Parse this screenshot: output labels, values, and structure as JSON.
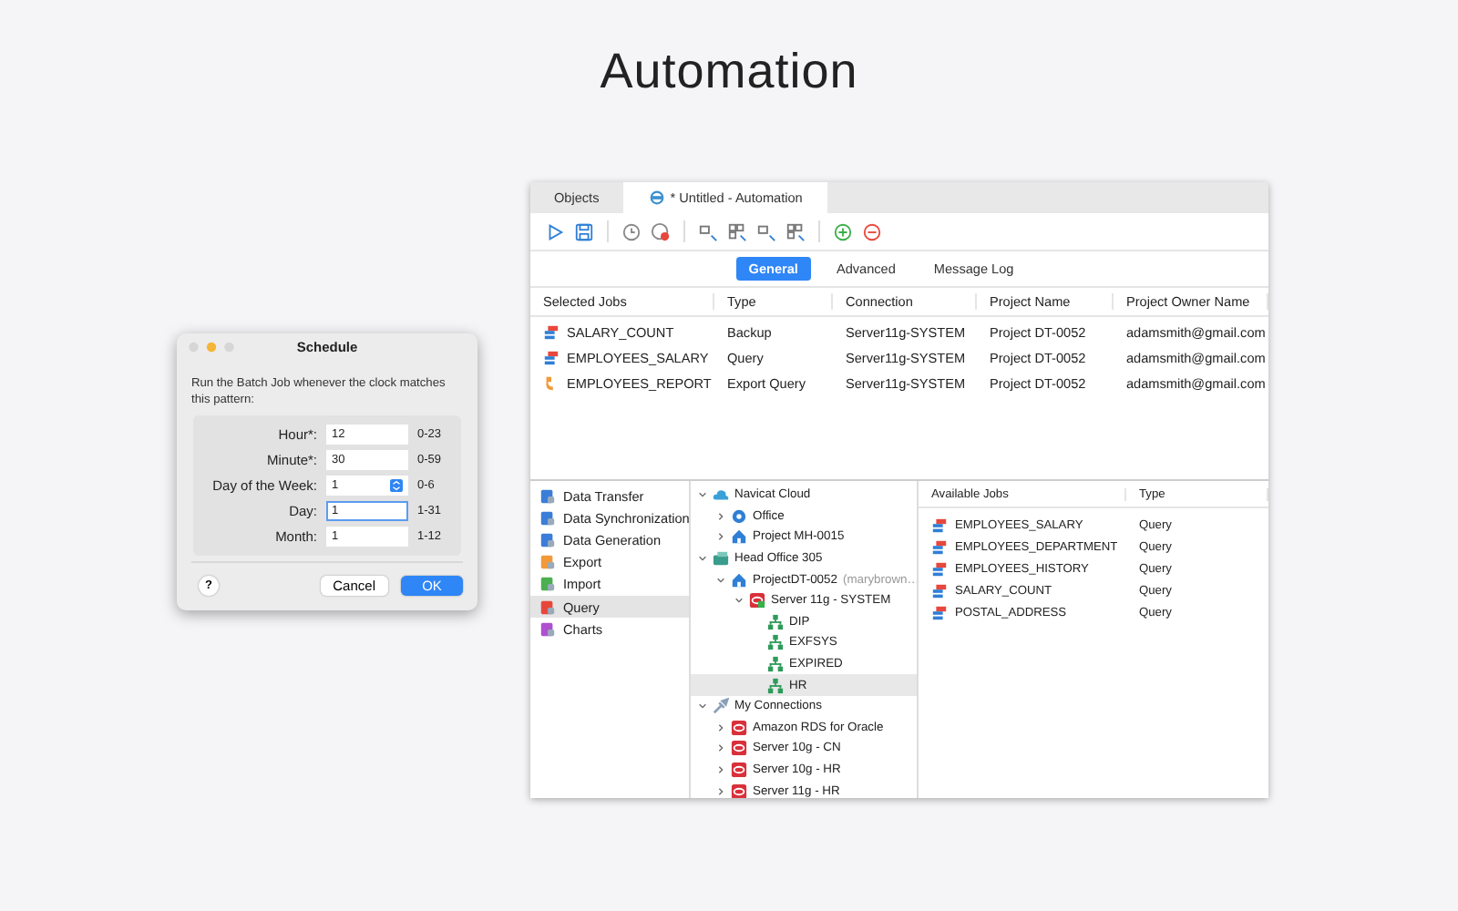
{
  "heading": "Automation",
  "main_window": {
    "tabs": [
      {
        "label": "Objects",
        "selected": false,
        "kind": "plain"
      },
      {
        "label": "* Untitled - Automation",
        "selected": true,
        "kind": "automation"
      }
    ],
    "view_tabs": [
      {
        "label": "General",
        "selected": true
      },
      {
        "label": "Advanced",
        "selected": false
      },
      {
        "label": "Message Log",
        "selected": false
      }
    ],
    "selected_jobs": {
      "columns": [
        "Selected Jobs",
        "Type",
        "Connection",
        "Project Name",
        "Project Owner Name"
      ],
      "rows": [
        {
          "kind": "backup",
          "cells": [
            "SALARY_COUNT",
            "Backup",
            "Server11g-SYSTEM",
            "Project DT-0052",
            "adamsmith@gmail.com"
          ]
        },
        {
          "kind": "query",
          "cells": [
            "EMPLOYEES_SALARY",
            "Query",
            "Server11g-SYSTEM",
            "Project DT-0052",
            "adamsmith@gmail.com"
          ]
        },
        {
          "kind": "export",
          "cells": [
            "EMPLOYEES_REPORT",
            "Export Query",
            "Server11g-SYSTEM",
            "Project DT-0052",
            "adamsmith@gmail.com"
          ]
        }
      ]
    },
    "job_types": [
      {
        "label": "Data Transfer",
        "kind": "transfer",
        "selected": false
      },
      {
        "label": "Data Synchronization",
        "kind": "sync",
        "selected": false
      },
      {
        "label": "Data Generation",
        "kind": "generation",
        "selected": false
      },
      {
        "label": "Export",
        "kind": "export",
        "selected": false
      },
      {
        "label": "Import",
        "kind": "import",
        "selected": false
      },
      {
        "label": "Query",
        "kind": "query",
        "selected": true
      },
      {
        "label": "Charts",
        "kind": "charts",
        "selected": false
      }
    ],
    "tree": [
      {
        "label": "Navicat Cloud",
        "kind": "cloud",
        "expanded": true,
        "selected": false,
        "children": [
          {
            "label": "Office",
            "kind": "group",
            "expanded": false,
            "selected": false
          },
          {
            "label": "Project MH-0015",
            "kind": "project",
            "expanded": false,
            "selected": false
          }
        ]
      },
      {
        "label": "Head Office 305",
        "kind": "server-group",
        "expanded": true,
        "selected": false,
        "children": [
          {
            "label": "ProjectDT-0052",
            "note": "(marybrown…",
            "kind": "project",
            "expanded": true,
            "selected": false,
            "children": [
              {
                "label": "Server 11g - SYSTEM",
                "kind": "oracle-connected",
                "expanded": true,
                "selected": false,
                "children": [
                  {
                    "label": "DIP",
                    "kind": "schema",
                    "selected": false
                  },
                  {
                    "label": "EXFSYS",
                    "kind": "schema",
                    "selected": false
                  },
                  {
                    "label": "EXPIRED",
                    "kind": "schema",
                    "selected": false
                  },
                  {
                    "label": "HR",
                    "kind": "schema",
                    "selected": true
                  }
                ]
              }
            ]
          }
        ]
      },
      {
        "label": "My Connections",
        "kind": "connections",
        "expanded": true,
        "selected": false,
        "children": [
          {
            "label": "Amazon RDS for Oracle",
            "kind": "rds",
            "expanded": false,
            "selected": false
          },
          {
            "label": "Server 10g - CN",
            "kind": "oracle",
            "expanded": false,
            "selected": false
          },
          {
            "label": "Server 10g - HR",
            "kind": "oracle",
            "expanded": false,
            "selected": false
          },
          {
            "label": "Server 11g - HR",
            "kind": "oracle",
            "expanded": false,
            "selected": false
          }
        ]
      }
    ],
    "available_jobs": {
      "columns": [
        "Available Jobs",
        "Type"
      ],
      "rows": [
        {
          "kind": "query",
          "cells": [
            "EMPLOYEES_SALARY",
            "Query"
          ]
        },
        {
          "kind": "query",
          "cells": [
            "EMPLOYEES_DEPARTMENT",
            "Query"
          ]
        },
        {
          "kind": "query",
          "cells": [
            "EMPLOYEES_HISTORY",
            "Query"
          ]
        },
        {
          "kind": "query",
          "cells": [
            "SALARY_COUNT",
            "Query"
          ]
        },
        {
          "kind": "query",
          "cells": [
            "POSTAL_ADDRESS",
            "Query"
          ]
        }
      ]
    }
  },
  "schedule_dialog": {
    "title": "Schedule",
    "description": "Run the Batch Job whenever the clock matches this pattern:",
    "fields": [
      {
        "label": "Hour*:",
        "value": "12",
        "range": "0-23",
        "kind": "text",
        "focused": false
      },
      {
        "label": "Minute*:",
        "value": "30",
        "range": "0-59",
        "kind": "text",
        "focused": false
      },
      {
        "label": "Day of the Week:",
        "value": "1",
        "range": "0-6",
        "kind": "select",
        "focused": false
      },
      {
        "label": "Day:",
        "value": "1",
        "range": "1-31",
        "kind": "text",
        "focused": true
      },
      {
        "label": "Month:",
        "value": "1",
        "range": "1-12",
        "kind": "text",
        "focused": false
      }
    ],
    "help": "?",
    "buttons": [
      {
        "label": "Cancel",
        "kind": "secondary"
      },
      {
        "label": "OK",
        "kind": "primary"
      }
    ]
  }
}
